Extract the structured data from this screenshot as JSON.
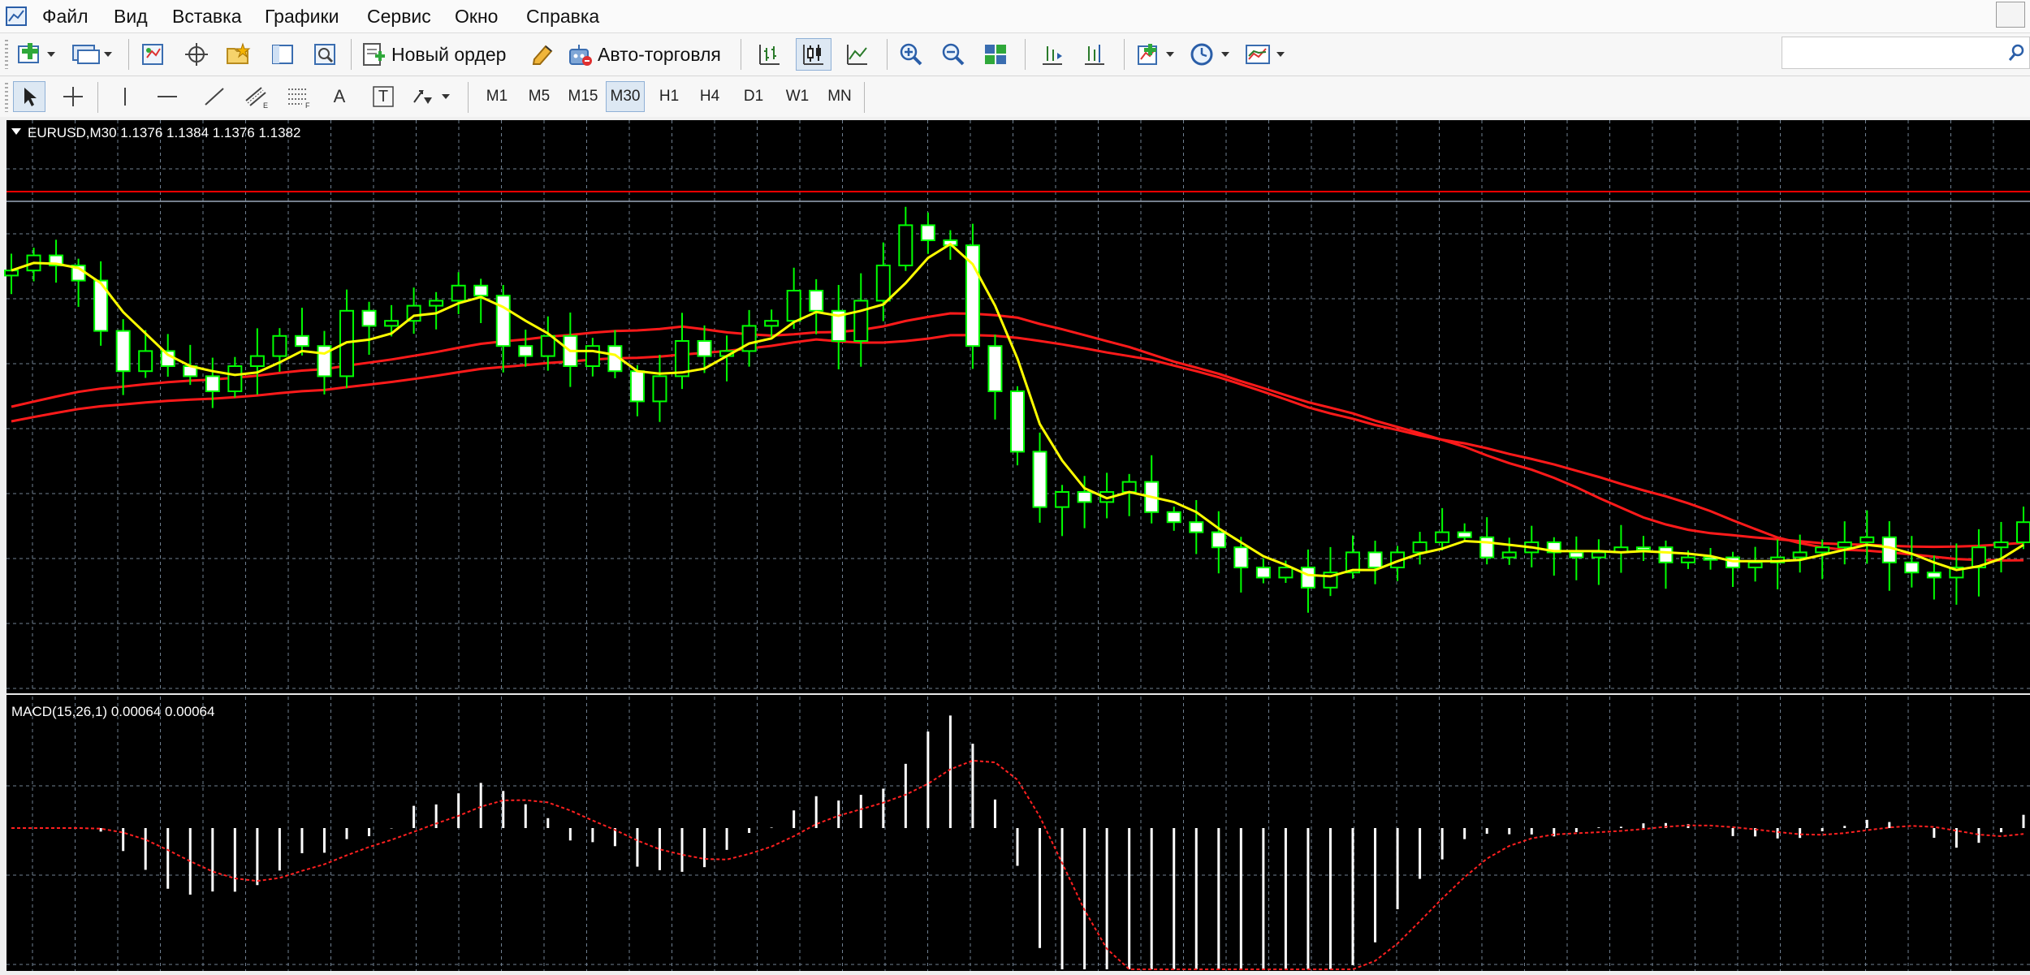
{
  "menu": {
    "items": [
      "Файл",
      "Вид",
      "Вставка",
      "Графики",
      "Сервис",
      "Окно",
      "Справка"
    ]
  },
  "toolbar": {
    "new_order_label": "Новый ордер",
    "autotrading_label": "Авто-торговля",
    "timeframes": [
      "M1",
      "M5",
      "M15",
      "M30",
      "H1",
      "H4",
      "D1",
      "W1",
      "MN"
    ],
    "active_timeframe": "M30",
    "text_tool_label": "A",
    "textbox_tool_label": "T"
  },
  "chart": {
    "header": "EURUSD,M30  1.1376 1.1384 1.1376 1.1382",
    "colors": {
      "background": "#000000",
      "grid": "#7a8a9a",
      "bull_candle": "#00ff00",
      "bear_candle": "#ffffff",
      "fast_ma": "#ffff00",
      "slow_ma": "#ff0000"
    }
  },
  "macd": {
    "header": "MACD(15,26,1) 0.00064 0.00064",
    "colors": {
      "histogram": "#ffffff",
      "signal": "#ff0000"
    }
  },
  "chart_data": [
    {
      "type": "candlestick",
      "title": "EURUSD,M30",
      "ohlc_readout": [
        1.1376,
        1.1384,
        1.1376,
        1.1382
      ],
      "relative_price_path": [
        0.16,
        0.13,
        0.15,
        0.18,
        0.28,
        0.36,
        0.32,
        0.35,
        0.37,
        0.4,
        0.35,
        0.33,
        0.29,
        0.31,
        0.37,
        0.24,
        0.27,
        0.26,
        0.23,
        0.22,
        0.19,
        0.21,
        0.31,
        0.33,
        0.29,
        0.35,
        0.31,
        0.36,
        0.42,
        0.37,
        0.3,
        0.33,
        0.32,
        0.27,
        0.26,
        0.2,
        0.24,
        0.3,
        0.22,
        0.15,
        0.07,
        0.1,
        0.11,
        0.31,
        0.4,
        0.52,
        0.63,
        0.6,
        0.62,
        0.6,
        0.58,
        0.64,
        0.66,
        0.68,
        0.71,
        0.75,
        0.77,
        0.75,
        0.79,
        0.76,
        0.72,
        0.75,
        0.72,
        0.7,
        0.68,
        0.69,
        0.73,
        0.72,
        0.7,
        0.72,
        0.73,
        0.72,
        0.71,
        0.71,
        0.74,
        0.73,
        0.73,
        0.75,
        0.74,
        0.73,
        0.72,
        0.71,
        0.7,
        0.69,
        0.74,
        0.76,
        0.77,
        0.75,
        0.71,
        0.7,
        0.66
      ],
      "overlays": [
        "fast moving average (yellow)",
        "slow moving averages (red, two lines)",
        "horizontal level (red)"
      ]
    },
    {
      "type": "bar",
      "title": "MACD(15,26,1)",
      "values_readout": [
        0.00064,
        0.00064
      ],
      "note": "histogram positive in first half, negative in second half, with dotted signal line"
    }
  ]
}
